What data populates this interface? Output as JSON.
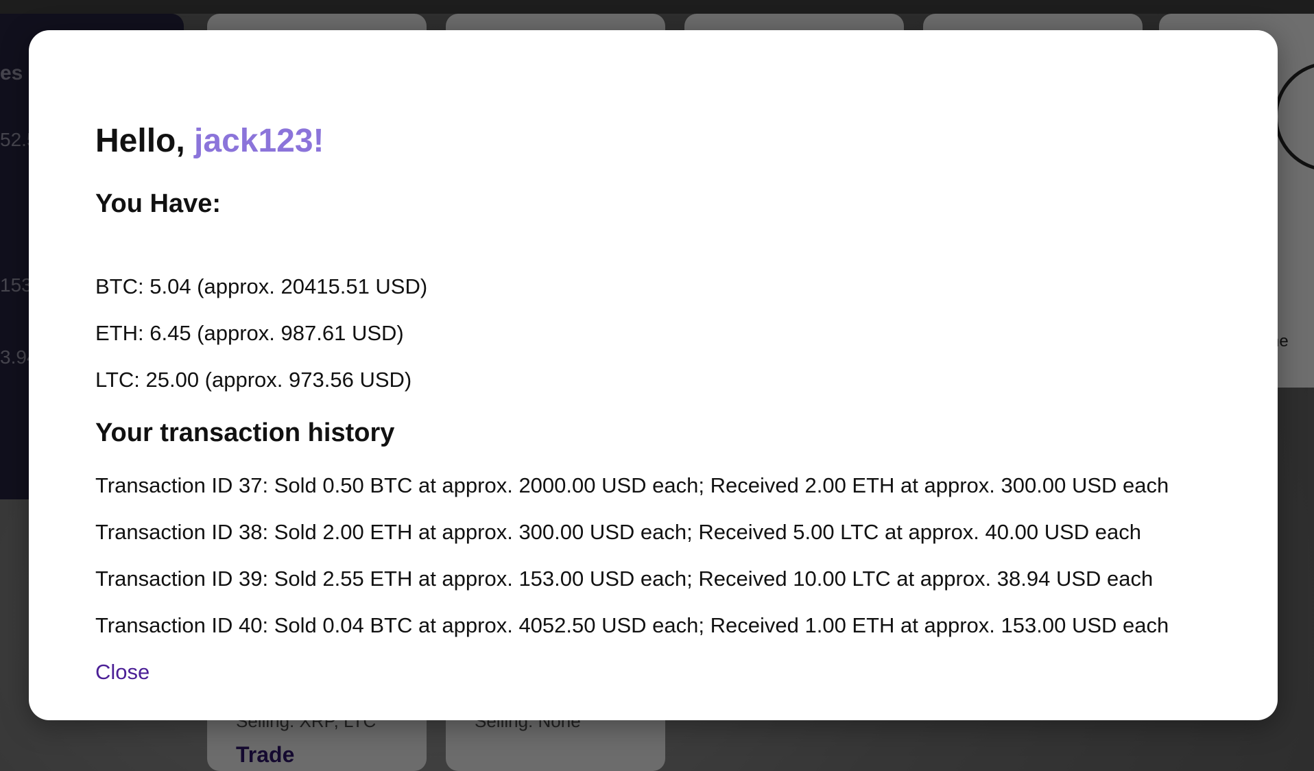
{
  "background": {
    "sidebar_peek": [
      "es",
      "52.5",
      "153",
      "3.94"
    ],
    "card_peek_labels": [
      "Selling: XRP, LTC",
      "Selling: None"
    ],
    "card_trade_label": "Trade",
    "right_panel_peek": "ne"
  },
  "modal": {
    "greeting_prefix": "Hello,",
    "username": "jack123!",
    "holdings_title": "You Have:",
    "holdings": [
      "BTC: 5.04 (approx. 20415.51 USD)",
      "ETH: 6.45 (approx. 987.61 USD)",
      "LTC: 25.00 (approx. 973.56 USD)"
    ],
    "history_title": "Your transaction history",
    "transactions": [
      "Transaction ID 37: Sold 0.50 BTC at approx. 2000.00 USD each; Received 2.00 ETH at approx. 300.00 USD each",
      "Transaction ID 38: Sold 2.00 ETH at approx. 300.00 USD each; Received 5.00 LTC at approx. 40.00 USD each",
      "Transaction ID 39: Sold 2.55 ETH at approx. 153.00 USD each; Received 10.00 LTC at approx. 38.94 USD each",
      "Transaction ID 40: Sold 0.04 BTC at approx. 4052.50 USD each; Received 1.00 ETH at approx. 153.00 USD each"
    ],
    "close_label": "Close"
  },
  "colors": {
    "username_accent": "#8b74da",
    "link": "#4b1f96",
    "sidebar": "#23203a"
  }
}
